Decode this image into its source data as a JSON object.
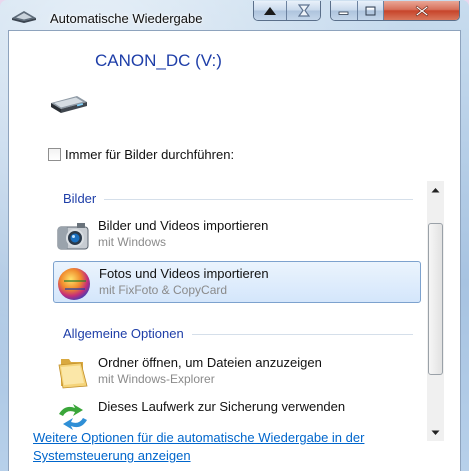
{
  "window": {
    "title": "Automatische Wiedergabe",
    "icon": "autoplay-icon"
  },
  "titlebar_buttons": {
    "back": "triangle-up-icon",
    "hourglass": "hourglass-icon",
    "minimize": "minimize-icon",
    "maximize": "maximize-icon",
    "close": "close-icon"
  },
  "device": {
    "name": "CANON_DC (V:)",
    "icon": "removable-drive-icon"
  },
  "always_option": {
    "label": "Immer für Bilder durchführen:",
    "checked": false
  },
  "groups": [
    {
      "heading": "Bilder",
      "items": [
        {
          "title": "Bilder und Videos importieren",
          "subtitle": "mit Windows",
          "icon": "camera-icon",
          "selected": false
        },
        {
          "title": "Fotos und Videos importieren",
          "subtitle": "mit FixFoto & CopyCard",
          "icon": "fixfoto-icon",
          "selected": true
        }
      ]
    },
    {
      "heading": "Allgemeine Optionen",
      "items": [
        {
          "title": "Ordner öffnen, um Dateien anzuzeigen",
          "subtitle": "mit Windows-Explorer",
          "icon": "folder-icon",
          "selected": false
        },
        {
          "title": "Dieses Laufwerk zur Sicherung verwenden",
          "subtitle": "",
          "icon": "backup-icon",
          "selected": false
        }
      ]
    }
  ],
  "footer_link": "Weitere Optionen für die automatische Wiedergabe in der Systemsteuerung anzeigen",
  "colors": {
    "heading_blue": "#1e3ea8",
    "link_blue": "#0066cc",
    "selection_border": "#7da2ce",
    "close_red": "#c7442a"
  }
}
